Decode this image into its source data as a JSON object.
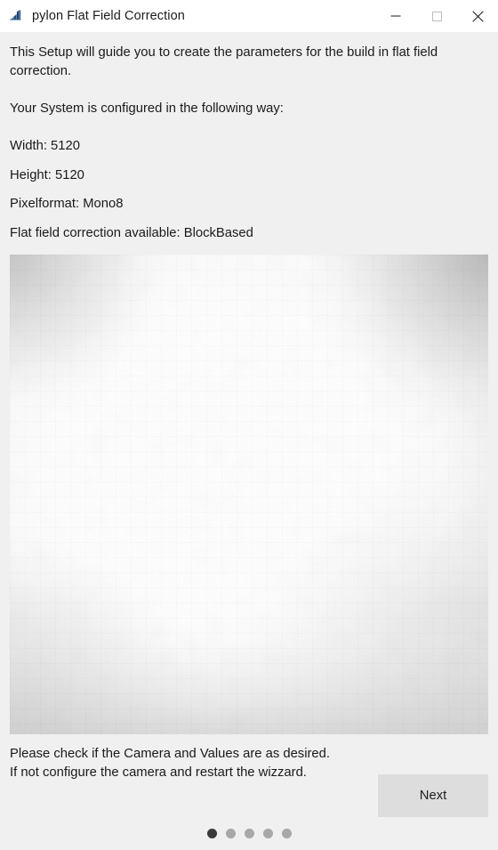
{
  "window": {
    "title": "pylon Flat Field Correction",
    "icon": "pylon-app-icon",
    "controls": {
      "minimize": "minimize-icon",
      "maximize": "maximize-icon",
      "close": "close-icon"
    },
    "titlebar_bg": "#ffffff",
    "content_bg": "#f0f0f0"
  },
  "body": {
    "intro": "This Setup will guide you to create the parameters for the build in flat field correction.",
    "subhead": "Your System is configured in the following way:",
    "params": [
      "Width: 5120",
      "Height: 5120",
      "Pixelformat: Mono8",
      "Flat field correction available: BlockBased"
    ]
  },
  "preview": {
    "name": "flat-field-preview-image",
    "description": "Grayscale flat field capture with block-based vignetting: bright white center, darker corners"
  },
  "footer": {
    "line1": "Please check if the Camera and Values are as desired.",
    "line2": "If not configure the camera and restart the wizzard.",
    "next_label": "Next",
    "next_bg": "#dddddd",
    "pager": {
      "total": 5,
      "active_index": 0,
      "active_color": "#3a3a3a",
      "inactive_color": "#a8a8a8"
    }
  }
}
